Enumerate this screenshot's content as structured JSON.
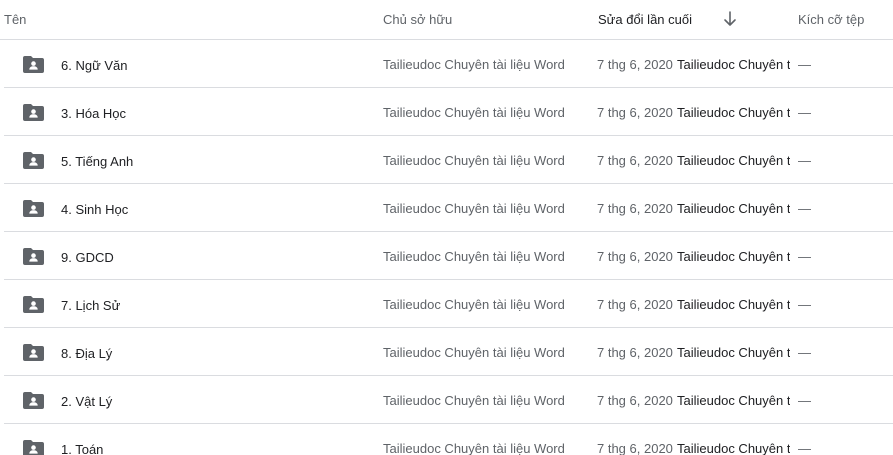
{
  "header": {
    "name": "Tên",
    "owner": "Chủ sở hữu",
    "modified": "Sửa đổi lần cuối",
    "size": "Kích cỡ tệp",
    "sort_icon": "arrow-down-icon"
  },
  "colors": {
    "icon": "#5f6368",
    "divider": "#dadce0",
    "text_primary": "#202124",
    "text_secondary": "#5f6368"
  },
  "rows": [
    {
      "name": "6. Ngữ Văn",
      "owner": "Tailieudoc Chuyên tài liệu Word",
      "date": "7 thg 6, 2020",
      "modifier": "Tailieudoc Chuyên tài liệu Word",
      "size": "—",
      "icon": "shared-folder-icon"
    },
    {
      "name": "3. Hóa Học",
      "owner": "Tailieudoc Chuyên tài liệu Word",
      "date": "7 thg 6, 2020",
      "modifier": "Tailieudoc Chuyên tài liệu Word",
      "size": "—",
      "icon": "shared-folder-icon"
    },
    {
      "name": "5. Tiếng Anh",
      "owner": "Tailieudoc Chuyên tài liệu Word",
      "date": "7 thg 6, 2020",
      "modifier": "Tailieudoc Chuyên tài liệu Word",
      "size": "—",
      "icon": "shared-folder-icon"
    },
    {
      "name": "4. Sinh Học",
      "owner": "Tailieudoc Chuyên tài liệu Word",
      "date": "7 thg 6, 2020",
      "modifier": "Tailieudoc Chuyên tài liệu Word",
      "size": "—",
      "icon": "shared-folder-icon"
    },
    {
      "name": "9. GDCD",
      "owner": "Tailieudoc Chuyên tài liệu Word",
      "date": "7 thg 6, 2020",
      "modifier": "Tailieudoc Chuyên tài liệu Word",
      "size": "—",
      "icon": "shared-folder-icon"
    },
    {
      "name": "7. Lịch Sử",
      "owner": "Tailieudoc Chuyên tài liệu Word",
      "date": "7 thg 6, 2020",
      "modifier": "Tailieudoc Chuyên tài liệu Word",
      "size": "—",
      "icon": "shared-folder-icon"
    },
    {
      "name": "8. Địa Lý",
      "owner": "Tailieudoc Chuyên tài liệu Word",
      "date": "7 thg 6, 2020",
      "modifier": "Tailieudoc Chuyên tài liệu Word",
      "size": "—",
      "icon": "shared-folder-icon"
    },
    {
      "name": "2. Vật Lý",
      "owner": "Tailieudoc Chuyên tài liệu Word",
      "date": "7 thg 6, 2020",
      "modifier": "Tailieudoc Chuyên tài liệu Word",
      "size": "—",
      "icon": "shared-folder-icon"
    },
    {
      "name": "1. Toán",
      "owner": "Tailieudoc Chuyên tài liệu Word",
      "date": "7 thg 6, 2020",
      "modifier": "Tailieudoc Chuyên tài liệu Word",
      "size": "—",
      "icon": "shared-folder-icon"
    }
  ]
}
